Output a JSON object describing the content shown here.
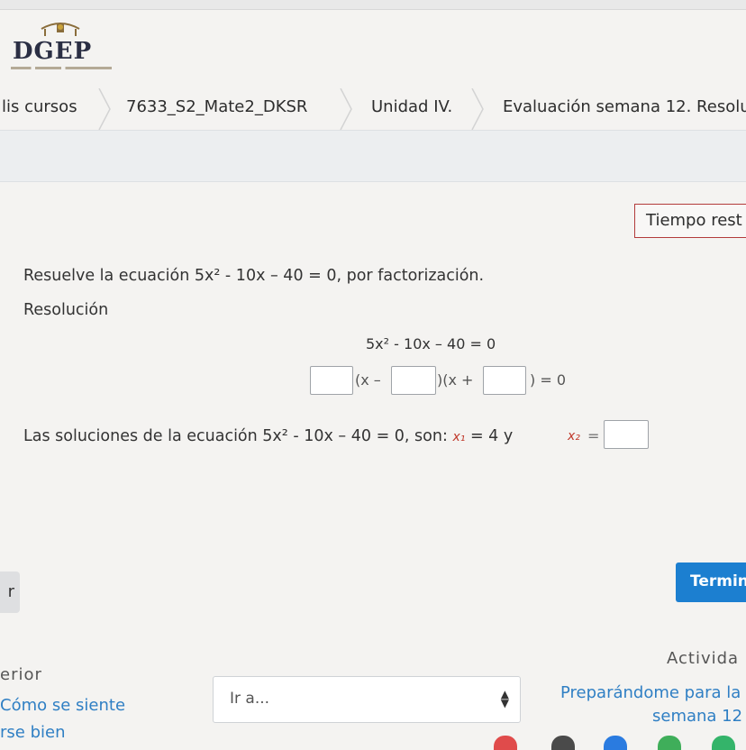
{
  "logo": {
    "text": "DGEP"
  },
  "breadcrumb": [
    {
      "label": "lis cursos"
    },
    {
      "label": "7633_S2_Mate2_DKSR"
    },
    {
      "label": "Unidad IV."
    },
    {
      "label": "Evaluación semana 12. Resolu"
    }
  ],
  "timer": {
    "label": "Tiempo rest"
  },
  "question": {
    "prompt": "Resuelve la ecuación 5x² - 10x – 40 = 0, por factorización.",
    "resolution_label": "Resolución",
    "equation_line": "5x² - 10x – 40 = 0",
    "factor_part1": "(x –",
    "factor_part2": ")(x +",
    "factor_part3": ") = 0",
    "solutions_text": "Las soluciones de la ecuación 5x² - 10x – 40 = 0, son:",
    "x1_label": "x₁",
    "x1_value": "= 4  y",
    "x2_label": "x₂",
    "x2_equals": "="
  },
  "buttons": {
    "finish": "Termin",
    "previous_page": "r"
  },
  "nav": {
    "previous_heading": "erior",
    "previous_link_line1": "Cómo se siente",
    "previous_link_line2": "rse bien",
    "jump_placeholder": "Ir a...",
    "next_heading": "Activida",
    "next_link_line1": "Preparándome para la",
    "next_link_line2": "semana 12"
  },
  "colors": {
    "primary_button": "#1c7fd0",
    "timer_border": "#b23b3b",
    "link": "#2f7fc4"
  }
}
